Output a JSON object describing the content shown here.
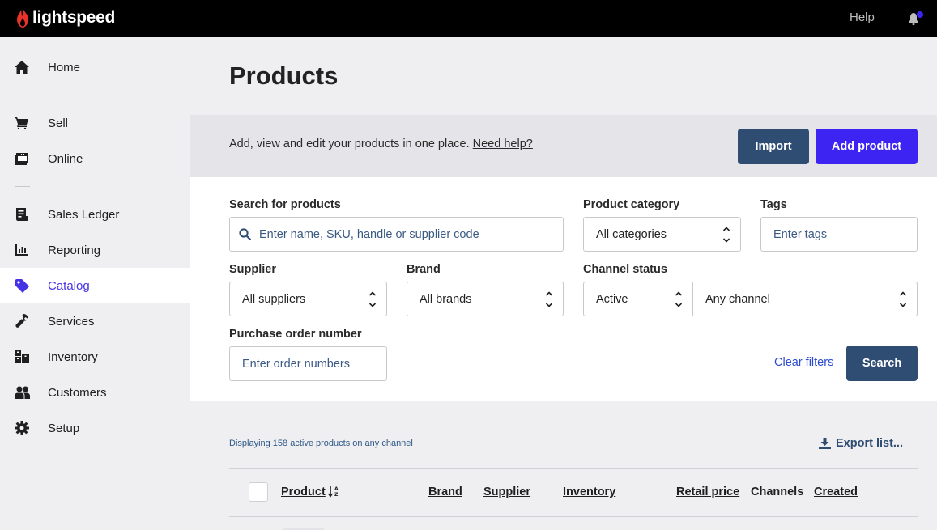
{
  "app": {
    "brand": "lightspeed",
    "help_label": "Help",
    "accent": "#4733e6",
    "notification_dot": "#3d24f2"
  },
  "sidebar": {
    "items": [
      {
        "label": "Home",
        "icon": "home-icon"
      },
      {
        "label": "Sell",
        "icon": "cart-icon"
      },
      {
        "label": "Online",
        "icon": "online-store-icon"
      },
      {
        "label": "Sales Ledger",
        "icon": "ledger-icon"
      },
      {
        "label": "Reporting",
        "icon": "bar-chart-icon"
      },
      {
        "label": "Catalog",
        "icon": "tag-icon",
        "active": true
      },
      {
        "label": "Services",
        "icon": "wrench-icon"
      },
      {
        "label": "Inventory",
        "icon": "boxes-icon"
      },
      {
        "label": "Customers",
        "icon": "people-icon"
      },
      {
        "label": "Setup",
        "icon": "gear-icon"
      }
    ]
  },
  "page": {
    "title": "Products",
    "intro": "Add, view and edit your products in one place.",
    "help_link": "Need help?",
    "import_label": "Import",
    "add_label": "Add product"
  },
  "filters": {
    "search_label": "Search for products",
    "search_placeholder": "Enter name, SKU, handle or supplier code",
    "category_label": "Product category",
    "category_value": "All categories",
    "tags_label": "Tags",
    "tags_placeholder": "Enter tags",
    "supplier_label": "Supplier",
    "supplier_value": "All suppliers",
    "brand_label": "Brand",
    "brand_value": "All brands",
    "channel_status_label": "Channel status",
    "status_value": "Active",
    "channel_value": "Any channel",
    "po_label": "Purchase order number",
    "po_placeholder": "Enter order numbers",
    "clear_label": "Clear filters",
    "search_button": "Search"
  },
  "list": {
    "summary": "Displaying 158 active products on any channel",
    "export_label": "Export list...",
    "columns": [
      "Product",
      "Brand",
      "Supplier",
      "Inventory",
      "Retail price",
      "Channels",
      "Created"
    ]
  }
}
